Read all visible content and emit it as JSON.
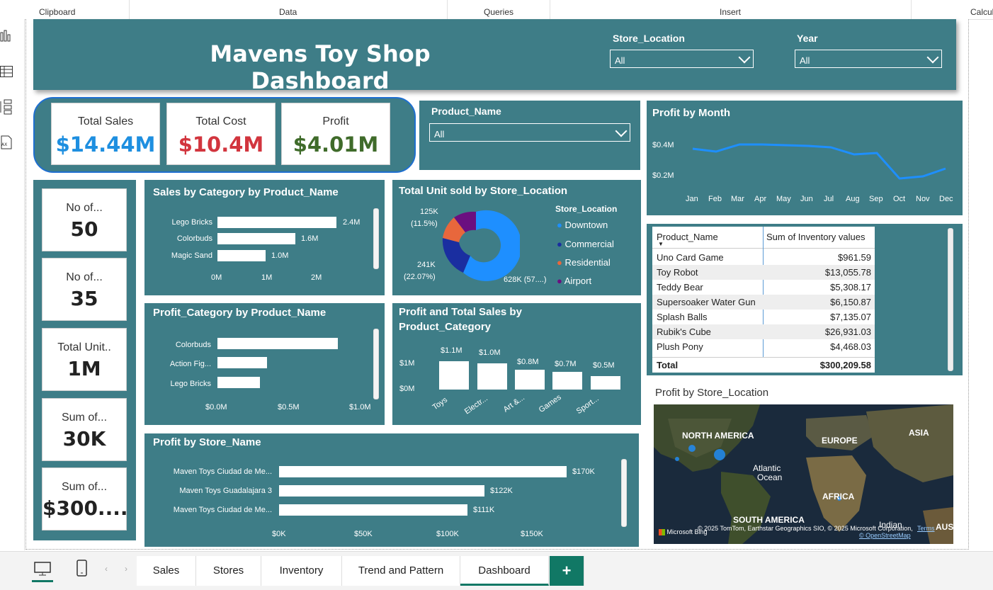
{
  "ribbon": {
    "groups": [
      "Clipboard",
      "Data",
      "Queries",
      "Insert",
      "Calcul"
    ]
  },
  "header": {
    "title": "Mavens Toy Shop Dashboard",
    "store_location_label": "Store_Location",
    "store_location_value": "All",
    "year_label": "Year",
    "year_value": "All"
  },
  "kpis": {
    "total_sales_label": "Total Sales",
    "total_sales_value": "$14.44M",
    "total_sales_color": "#1e8fe0",
    "total_cost_label": "Total Cost",
    "total_cost_value": "$10.4M",
    "total_cost_color": "#d2353e",
    "profit_label": "Profit",
    "profit_value": "$4.01M",
    "profit_color": "#3f6b2a"
  },
  "product_slicer": {
    "label": "Product_Name",
    "value": "All"
  },
  "cards": [
    {
      "label": "No of...",
      "value": "50"
    },
    {
      "label": "No of...",
      "value": "35"
    },
    {
      "label": "Total Unit..",
      "value": "1M"
    },
    {
      "label": "Sum of...",
      "value": "30K"
    },
    {
      "label": "Sum of...",
      "value": "$300...."
    }
  ],
  "sales_by_category": {
    "title": "Sales by Category by Product_Name",
    "chart_data": {
      "type": "bar",
      "categories": [
        "Lego Bricks",
        "Colorbuds",
        "Magic Sand"
      ],
      "values": [
        2.4,
        1.6,
        1.0
      ],
      "data_labels": [
        "2.4M",
        "1.6M",
        "1.0M"
      ],
      "xticks": [
        "0M",
        "1M",
        "2M"
      ],
      "xlim": [
        0,
        2.6
      ]
    }
  },
  "units_by_store": {
    "title": "Total Unit sold by Store_Location",
    "legend_title": "Store_Location",
    "chart_data": {
      "type": "pie",
      "categories": [
        "Downtown",
        "Commercial",
        "Residential",
        "Airport"
      ],
      "values": [
        628,
        241,
        75,
        50
      ],
      "colors": [
        "#1e8fff",
        "#1a2ea0",
        "#e8673c",
        "#6b0f80"
      ],
      "labels": [
        "628K (57....)",
        "241K\n(22.07%)",
        "",
        "125K\n(11.5%)"
      ]
    },
    "label_125": "125K",
    "label_125_pct": "(11.5%)",
    "label_241": "241K",
    "label_241_pct": "(22.07%)",
    "label_628": "628K (57....)"
  },
  "profit_by_month": {
    "title": "Profit by Month",
    "chart_data": {
      "type": "line",
      "categories": [
        "Jan",
        "Feb",
        "Mar",
        "Apr",
        "May",
        "Jun",
        "Jul",
        "Aug",
        "Sep",
        "Oct",
        "Nov",
        "Dec"
      ],
      "values": [
        0.38,
        0.36,
        0.4,
        0.4,
        0.39,
        0.39,
        0.38,
        0.34,
        0.35,
        0.2,
        0.22,
        0.27
      ],
      "yticks": [
        "$0.4M",
        "$0.2M"
      ],
      "ylim": [
        0.1,
        0.5
      ]
    }
  },
  "profit_category": {
    "title": "Profit_Category by Product_Name",
    "chart_data": {
      "type": "bar",
      "categories": [
        "Colorbuds",
        "Action Fig...",
        "Lego Bricks"
      ],
      "values": [
        0.85,
        0.35,
        0.3
      ],
      "xticks": [
        "$0.0M",
        "$0.5M",
        "$1.0M"
      ],
      "xlim": [
        0,
        1.0
      ]
    }
  },
  "profit_and_sales": {
    "title_line1": "Profit and Total Sales by",
    "title_line2": "Product_Category",
    "chart_data": {
      "type": "bar",
      "categories": [
        "Toys",
        "Electr...",
        "Art &...",
        "Games",
        "Sport..."
      ],
      "values": [
        1.1,
        1.0,
        0.8,
        0.7,
        0.5
      ],
      "data_labels": [
        "$1.1M",
        "$1.0M",
        "$0.8M",
        "$0.7M",
        "$0.5M"
      ],
      "yticks": [
        "$1M",
        "$0M"
      ],
      "ylim": [
        0,
        1.2
      ]
    }
  },
  "profit_by_store_name": {
    "title": "Profit by Store_Name",
    "chart_data": {
      "type": "bar",
      "categories": [
        "Maven Toys Ciudad de Me...",
        "Maven Toys Guadalajara 3",
        "Maven Toys Ciudad de Me..."
      ],
      "values": [
        170,
        122,
        111
      ],
      "data_labels": [
        "$170K",
        "$122K",
        "$111K"
      ],
      "xticks": [
        "$0K",
        "$50K",
        "$100K",
        "$150K"
      ],
      "xlim": [
        0,
        175
      ]
    }
  },
  "inventory_table": {
    "col1": "Product_Name",
    "col2": "Sum of Inventory values",
    "rows": [
      {
        "name": "Uno Card Game",
        "value": "$961.59"
      },
      {
        "name": "Toy Robot",
        "value": "$13,055.78"
      },
      {
        "name": "Teddy Bear",
        "value": "$5,308.17"
      },
      {
        "name": "Supersoaker Water Gun",
        "value": "$6,150.87"
      },
      {
        "name": "Splash Balls",
        "value": "$7,135.07"
      },
      {
        "name": "Rubik's Cube",
        "value": "$26,931.03"
      },
      {
        "name": "Plush Pony",
        "value": "$4,468.03"
      }
    ],
    "total_label": "Total",
    "total_value": "$300,209.58"
  },
  "map": {
    "title": "Profit by Store_Location",
    "labels": [
      "NORTH AMERICA",
      "EUROPE",
      "ASIA",
      "Atlantic",
      "Ocean",
      "AFRICA",
      "SOUTH AMERICA",
      "Indian",
      "AUS"
    ],
    "brand": "Microsoft Bing",
    "attribution": "© 2025 TomTom, Earthstar Geographics SIO, © 2025 Microsoft Corporation,",
    "terms": "Terms",
    "osm": "© OpenStreetMap"
  },
  "tabs": [
    "Sales",
    "Stores",
    "Inventory",
    "Trend and Pattern",
    "Dashboard"
  ],
  "active_tab": "Dashboard",
  "add_tab": "+"
}
